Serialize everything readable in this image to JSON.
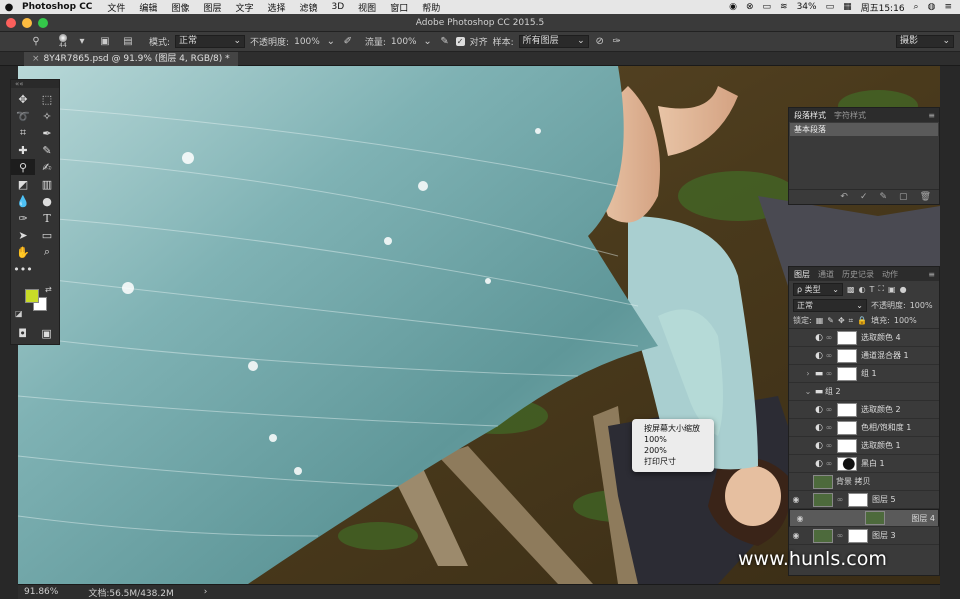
{
  "menubar": {
    "apple": "",
    "app_name": "Photoshop CC",
    "items": [
      "文件",
      "编辑",
      "图像",
      "图层",
      "文字",
      "选择",
      "滤镜",
      "3D",
      "视图",
      "窗口",
      "帮助"
    ],
    "battery": "34%",
    "clock": "周五15:16"
  },
  "window": {
    "title": "Adobe Photoshop CC 2015.5"
  },
  "options": {
    "brush_size": "44",
    "mode_label": "模式:",
    "mode_value": "正常",
    "opacity_label": "不透明度:",
    "opacity_value": "100%",
    "flow_label": "流量:",
    "flow_value": "100%",
    "align_label": "对齐",
    "sample_label": "样本:",
    "sample_value": "所有图层",
    "workspace": "摄影"
  },
  "document": {
    "tab": "8Y4R7865.psd @ 91.9% (图层 4, RGB/8) *"
  },
  "status": {
    "zoom": "91.86%",
    "doc_size": "文档:56.5M/438.2M",
    "arrow": "›"
  },
  "toolbox": {
    "grip": "««",
    "more": "•••"
  },
  "paragraph_panel": {
    "tabs": [
      "段落样式",
      "字符样式"
    ],
    "style": "基本段落",
    "buttons": [
      "↶",
      "✓",
      "✎",
      "▢",
      "🗑"
    ]
  },
  "layers_panel": {
    "tabs": [
      "图层",
      "通道",
      "历史记录",
      "动作"
    ],
    "filter_label": "ρ 类型",
    "blend_mode": "正常",
    "opacity_label": "不透明度:",
    "opacity_value": "100%",
    "lock_label": "锁定:",
    "fill_label": "填充:",
    "fill_value": "100%",
    "layers": [
      {
        "name": "选取颜色 4",
        "kind": "adj"
      },
      {
        "name": "通道混合器 1",
        "kind": "adj"
      },
      {
        "name": "组 1",
        "kind": "group"
      },
      {
        "name": "组 2",
        "kind": "group-open"
      },
      {
        "name": "选取颜色 2",
        "kind": "adj"
      },
      {
        "name": "色相/饱和度 1",
        "kind": "adj"
      },
      {
        "name": "选取颜色 1",
        "kind": "adj"
      },
      {
        "name": "黑白 1",
        "kind": "adj-bw"
      },
      {
        "name": "背景 拷贝",
        "kind": "pixel"
      },
      {
        "name": "图层 5",
        "kind": "pixel-mask"
      },
      {
        "name": "图层 4",
        "kind": "pixel",
        "selected": true
      },
      {
        "name": "图层 3",
        "kind": "pixel-mask"
      }
    ]
  },
  "context_menu": {
    "items": [
      "按屏幕大小缩放",
      "100%",
      "200%",
      "打印尺寸"
    ]
  },
  "watermark": "www.hunls.com",
  "colors": {
    "foreground": "#c8dc28",
    "background": "#ffffff",
    "accent": "#5a5a5a"
  }
}
